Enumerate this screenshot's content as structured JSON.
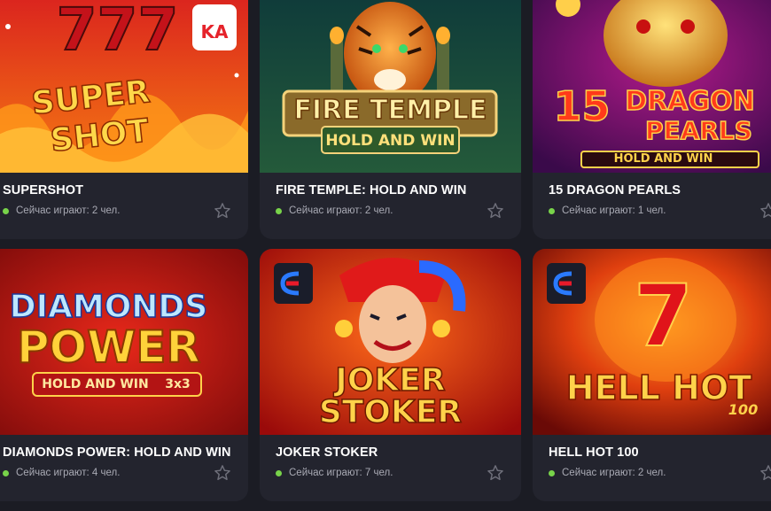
{
  "games": [
    {
      "title": "SUPERSHOT",
      "online_text": "Сейчас играют: 2 чел.",
      "art_lines": [
        "777",
        "SUPER",
        "SHOT"
      ],
      "provider_badge_text": "KA"
    },
    {
      "title": "FIRE TEMPLE: HOLD AND WIN",
      "online_text": "Сейчас играют: 2 чел.",
      "art_lines": [
        "FIRE TEMPLE",
        "HOLD AND WIN"
      ]
    },
    {
      "title": "15 DRAGON PEARLS",
      "online_text": "Сейчас играют: 1 чел.",
      "art_lines": [
        "15",
        "DRAGON",
        "PEARLS",
        "HOLD AND WIN"
      ]
    },
    {
      "title": "DIAMONDS POWER: HOLD AND WIN",
      "online_text": "Сейчас играют: 4 чел.",
      "art_lines": [
        "DIAMONDS",
        "POWER",
        "HOLD AND WIN",
        "3x3"
      ]
    },
    {
      "title": "JOKER STOKER",
      "online_text": "Сейчас играют: 7 чел.",
      "art_lines": [
        "JOKER",
        "STOKER"
      ]
    },
    {
      "title": "HELL HOT 100",
      "online_text": "Сейчас играют: 2 чел.",
      "art_lines": [
        "7",
        "HELL HOT",
        "100"
      ]
    }
  ],
  "colors": {
    "page_bg": "#1b1c24",
    "card_bg": "#23242e",
    "online_dot": "#78d34a",
    "star": "#6e6f7a"
  },
  "icons": [
    "star-icon",
    "online-dot-icon",
    "provider-logo-icon"
  ]
}
